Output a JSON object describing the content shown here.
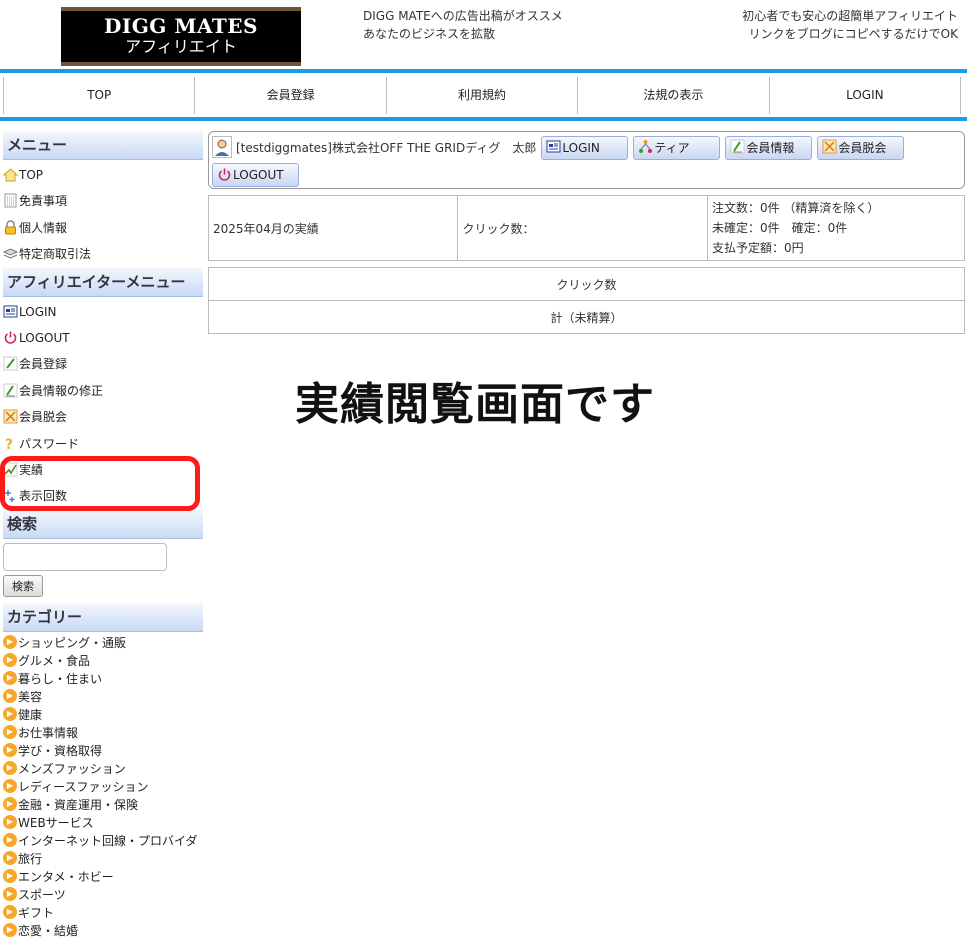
{
  "header": {
    "logo_line1": "DIGG MATES",
    "logo_line2": "アフィリエイト",
    "left_line1": "DIGG MATEへの広告出稿がオススメ",
    "left_line2": "あなたのビジネスを拡散",
    "right_line1": "初心者でも安心の超簡単アフィリエイト",
    "right_line2": "リンクをブログにコピペするだけでOK"
  },
  "nav": [
    {
      "label": "TOP"
    },
    {
      "label": "会員登録"
    },
    {
      "label": "利用規約"
    },
    {
      "label": "法規の表示"
    },
    {
      "label": "LOGIN"
    }
  ],
  "sidebar": {
    "menu_title": "メニュー",
    "menu": [
      {
        "label": "TOP",
        "icon": "home-icon"
      },
      {
        "label": "免責事項",
        "icon": "document-icon"
      },
      {
        "label": "個人情報",
        "icon": "lock-icon"
      },
      {
        "label": "特定商取引法",
        "icon": "stack-icon"
      }
    ],
    "aff_title": "アフィリエイターメニュー",
    "aff_menu": [
      {
        "label": "LOGIN",
        "icon": "login-icon"
      },
      {
        "label": "LOGOUT",
        "icon": "power-icon"
      },
      {
        "label": "会員登録",
        "icon": "pencil-icon"
      },
      {
        "label": "会員情報の修正",
        "icon": "edit-icon"
      },
      {
        "label": "会員脱会",
        "icon": "cancel-icon"
      },
      {
        "label": "パスワード",
        "icon": "question-icon"
      },
      {
        "label": "実績",
        "icon": "chart-icon"
      },
      {
        "label": "表示回数",
        "icon": "counter-icon"
      }
    ],
    "search_title": "検索",
    "search_button": "検索",
    "category_title": "カテゴリー",
    "categories": [
      "ショッピング・通販",
      "グルメ・食品",
      "暮らし・住まい",
      "美容",
      "健康",
      "お仕事情報",
      "学び・資格取得",
      "メンズファッション",
      "レディースファッション",
      "金融・資産運用・保険",
      "WEBサービス",
      "インターネット回線・プロバイダ",
      "旅行",
      "エンタメ・ホビー",
      "スポーツ",
      "ギフト",
      "恋愛・結婚"
    ]
  },
  "user": {
    "name": "[testdiggmates]株式会社OFF THE GRIDディグ　太郎",
    "buttons": [
      "LOGIN",
      "ティア",
      "会員情報",
      "会員脱会",
      "LOGOUT"
    ]
  },
  "stats": {
    "period": "2025年04月の実績",
    "clicks_label": "クリック数：",
    "orders": "注文数：0件 （精算済を除く）",
    "pending": "未確定：0件　確定：0件",
    "payment": "支払予定額：0円"
  },
  "click_table": {
    "header": "クリック数",
    "total": "計（未精算）"
  },
  "overlay_text": "実績閲覧画面です"
}
